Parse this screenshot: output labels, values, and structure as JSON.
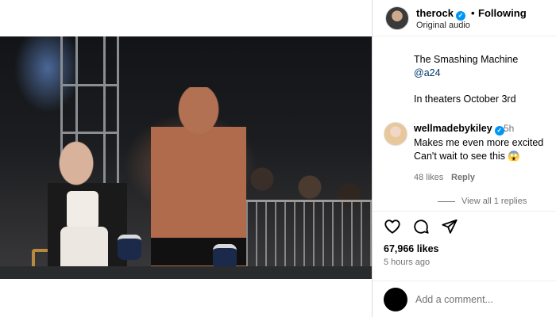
{
  "post": {
    "author": "therock",
    "verified": true,
    "separator": "•",
    "follow_status": "Following",
    "audio": "Original audio"
  },
  "caption": {
    "line1": "The Smashing Machine",
    "mention": "@a24",
    "line3": "In theaters October 3rd"
  },
  "comment": {
    "user": "wellmadebykiley",
    "verified": true,
    "time": "5h",
    "text_line1": "Makes me even more excited",
    "text_line2": "Can't wait to see this 😱",
    "likes": "48 likes",
    "reply_label": "Reply"
  },
  "replies": {
    "label": "View all 1 replies"
  },
  "actions": {
    "icons": [
      "heart-icon",
      "comment-icon",
      "share-icon"
    ]
  },
  "stats": {
    "likes": "67,966 likes",
    "posted": "5 hours ago"
  },
  "add_comment": {
    "placeholder": "Add a comment..."
  },
  "colors": {
    "verified": "#0095f6",
    "mention": "#00376b",
    "secondary_text": "#737373"
  }
}
